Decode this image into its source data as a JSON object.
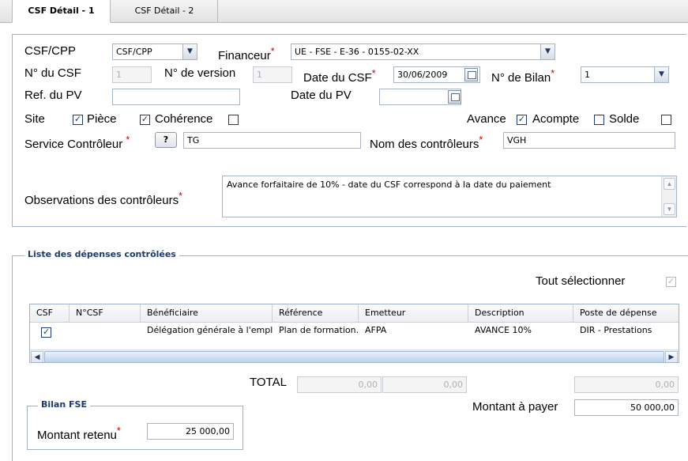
{
  "tabs": [
    {
      "label": "CSF Détail - 1"
    },
    {
      "label": "CSF Détail - 2"
    }
  ],
  "form": {
    "csf_cpp_label": "CSF/CPP",
    "csf_cpp_value": "CSF/CPP",
    "financeur_label": "Financeur",
    "financeur_value": "UE - FSE - E-36 - 0155-02-XX",
    "num_csf_label": "N° du CSF",
    "num_csf_value": "1",
    "num_version_label": "N° de version",
    "num_version_value": "1",
    "date_csf_label": "Date du CSF",
    "date_csf_value": "30/06/2009",
    "num_bilan_label": "N° de Bilan",
    "num_bilan_value": "1",
    "ref_pv_label": "Ref. du PV",
    "ref_pv_value": "",
    "date_pv_label": "Date du PV",
    "date_pv_value": "",
    "site_label": "Site",
    "piece_label": "Pièce",
    "piece_checked": true,
    "coherence_label": "Cohérence",
    "coherence_checked": false,
    "site_checked": true,
    "avance_label": "Avance",
    "avance_checked": true,
    "acompte_label": "Acompte",
    "acompte_checked": false,
    "solde_label": "Solde",
    "solde_checked": false,
    "service_label": "Service Contrôleur",
    "service_help": "?",
    "service_value": "TG",
    "nom_controleurs_label": "Nom des contrôleurs",
    "nom_controleurs_value": "VGH",
    "observations_label": "Observations des contrôleurs",
    "observations_value": "Avance forfaitaire de 10% - date du CSF correspond à la date du paiement",
    "required_mark": "*"
  },
  "depenses": {
    "legend": "Liste des dépenses contrôlées",
    "select_all_label": "Tout sélectionner",
    "select_all_checked": true,
    "columns": [
      "CSF",
      "N°CSF",
      "Bénéficiaire",
      "Référence",
      "Emetteur",
      "Description",
      "Poste de dépense"
    ],
    "rows": [
      {
        "csf_checked": true,
        "num_csf": "",
        "beneficiaire": "Délégation générale à l'empl...",
        "reference": "Plan de formation...",
        "emetteur": "AFPA",
        "description": "AVANCE 10%",
        "poste": "DIR - Prestations"
      }
    ],
    "total_label": "TOTAL",
    "total_1": "0,00",
    "total_2": "0,00",
    "total_3": "0,00",
    "montant_payer_label": "Montant à payer",
    "montant_payer_value": "50 000,00"
  },
  "bilan": {
    "legend": "Bilan FSE",
    "montant_retenu_label": "Montant retenu",
    "montant_retenu_value": "25 000,00"
  }
}
